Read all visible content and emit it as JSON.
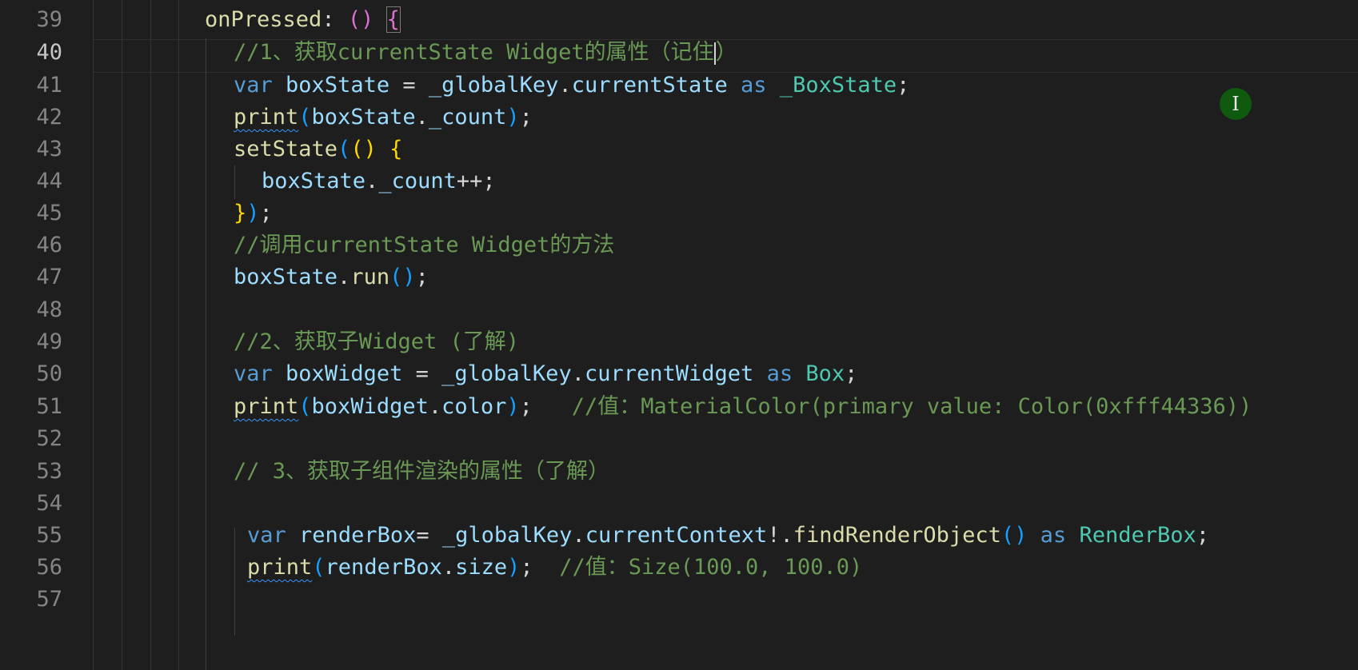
{
  "editor": {
    "active_line": 40,
    "line_numbers": [
      "39",
      "40",
      "41",
      "42",
      "43",
      "44",
      "45",
      "46",
      "47",
      "48",
      "49",
      "50",
      "51",
      "52",
      "53",
      "54",
      "55",
      "56",
      "57"
    ]
  },
  "code": {
    "l39": [
      "onPressed",
      ": ",
      "(",
      ")",
      " ",
      "{"
    ],
    "l40": [
      "//1、获取currentState Widget的属性（记住",
      "）"
    ],
    "l41": [
      "var",
      " ",
      "boxState",
      " = ",
      "_globalKey",
      ".",
      "currentState",
      " ",
      "as",
      " ",
      "_BoxState",
      ";"
    ],
    "l42": [
      "print",
      "(",
      "boxState",
      ".",
      "_count",
      ")",
      ";"
    ],
    "l43": [
      "setState",
      "(",
      "()",
      " ",
      "{"
    ],
    "l44": [
      "boxState",
      ".",
      "_count",
      "++;"
    ],
    "l45": [
      "}",
      ")",
      ";"
    ],
    "l46": [
      "//调用currentState Widget的方法"
    ],
    "l47": [
      "boxState",
      ".",
      "run",
      "()",
      ";"
    ],
    "l49": [
      "//2、获取子Widget (了解)"
    ],
    "l50": [
      "var",
      " ",
      "boxWidget",
      " = ",
      "_globalKey",
      ".",
      "currentWidget",
      " ",
      "as",
      " ",
      "Box",
      ";"
    ],
    "l51": [
      "print",
      "(",
      "boxWidget",
      ".",
      "color",
      ")",
      ";",
      "   ",
      "//值：MaterialColor(primary value: Color(0xfff44336))"
    ],
    "l53": [
      "// 3、获取子组件渲染的属性（了解）"
    ],
    "l55": [
      "var",
      " ",
      "renderBox",
      "= ",
      "_globalKey",
      ".",
      "currentContext",
      "!.",
      "findRenderObject",
      "()",
      " ",
      "as",
      " ",
      "RenderBox",
      ";"
    ],
    "l56": [
      "print",
      "(",
      "renderBox",
      ".",
      "size",
      ")",
      ";",
      "  ",
      "//值：Size(100.0, 100.0)"
    ]
  },
  "colors": {
    "background": "#1e1e1e",
    "keyword": "#569cd6",
    "variable": "#9cdcfe",
    "function": "#dcdcaa",
    "type": "#4ec9b0",
    "comment": "#6a9955",
    "bracket_gold": "#ffd700",
    "bracket_orchid": "#da70d6",
    "bracket_blue": "#179fff"
  },
  "icons": {
    "mouse_cursor": "i-beam-cursor-icon"
  }
}
